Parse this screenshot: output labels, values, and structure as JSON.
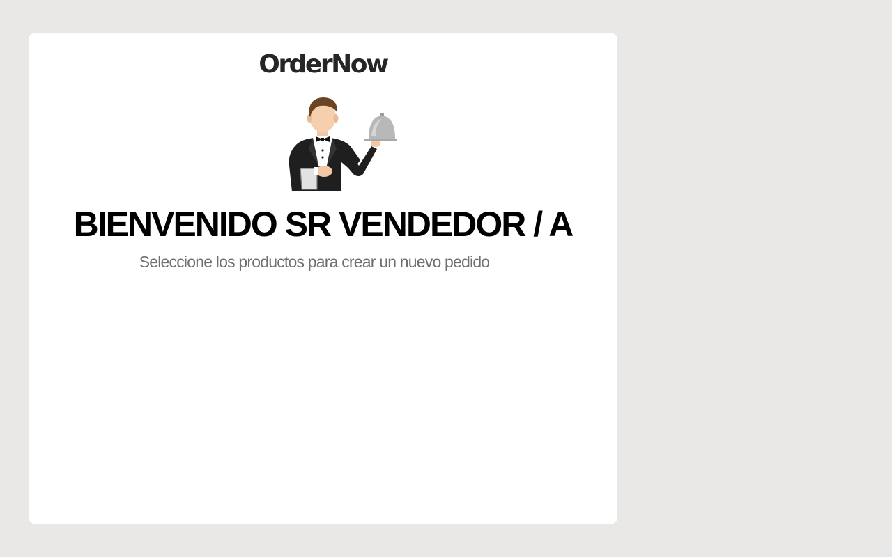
{
  "app": {
    "logo_text": "OrderNow"
  },
  "illustration": {
    "icon": "waiter-with-cloche-icon"
  },
  "welcome": {
    "title": "BIENVENIDO SR VENDEDOR / A",
    "subtitle": "Seleccione los productos para crear un nuevo pedido"
  },
  "colors": {
    "background": "#e9e8e6",
    "card": "#ffffff",
    "title": "#000000",
    "subtitle": "#6f6f6f",
    "logo": "#262626"
  }
}
